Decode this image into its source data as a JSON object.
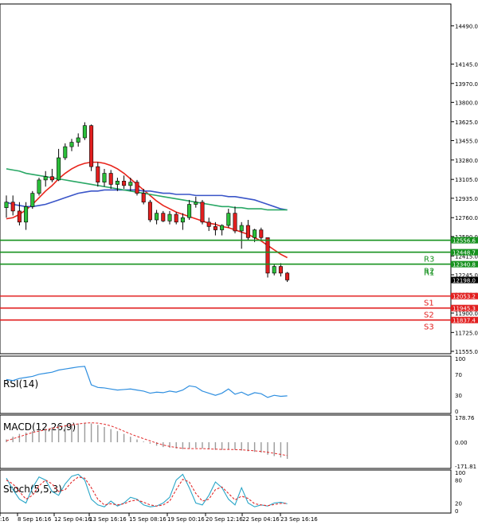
{
  "chart_data": [
    {
      "type": "candlestick",
      "name": "price",
      "ylim": [
        11555.0,
        14665.0
      ],
      "y_ticks": [
        "14490.0",
        "14145.0",
        "13970.0",
        "13800.0",
        "13625.0",
        "13455.0",
        "13280.0",
        "13105.0",
        "12935.0",
        "12760.0",
        "12590.0",
        "12415.0",
        "12245.0",
        "12070.0",
        "11900.0",
        "11725.0",
        "11555.0"
      ],
      "candles": [
        {
          "o": 12850,
          "h": 12960,
          "l": 12760,
          "c": 12900
        },
        {
          "o": 12900,
          "h": 12960,
          "l": 12780,
          "c": 12820
        },
        {
          "o": 12820,
          "h": 12900,
          "l": 12690,
          "c": 12720
        },
        {
          "o": 12720,
          "h": 12900,
          "l": 12650,
          "c": 12860
        },
        {
          "o": 12860,
          "h": 13000,
          "l": 12840,
          "c": 12980
        },
        {
          "o": 12980,
          "h": 13120,
          "l": 12960,
          "c": 13100
        },
        {
          "o": 13100,
          "h": 13180,
          "l": 13040,
          "c": 13130
        },
        {
          "o": 13130,
          "h": 13200,
          "l": 13080,
          "c": 13100
        },
        {
          "o": 13100,
          "h": 13380,
          "l": 13090,
          "c": 13300
        },
        {
          "o": 13300,
          "h": 13430,
          "l": 13280,
          "c": 13400
        },
        {
          "o": 13400,
          "h": 13470,
          "l": 13360,
          "c": 13440
        },
        {
          "o": 13440,
          "h": 13520,
          "l": 13400,
          "c": 13480
        },
        {
          "o": 13480,
          "h": 13620,
          "l": 13460,
          "c": 13590
        },
        {
          "o": 13590,
          "h": 13600,
          "l": 13180,
          "c": 13220
        },
        {
          "o": 13220,
          "h": 13260,
          "l": 13040,
          "c": 13080
        },
        {
          "o": 13080,
          "h": 13200,
          "l": 13040,
          "c": 13160
        },
        {
          "o": 13160,
          "h": 13190,
          "l": 13020,
          "c": 13060
        },
        {
          "o": 13060,
          "h": 13120,
          "l": 13000,
          "c": 13090
        },
        {
          "o": 13090,
          "h": 13140,
          "l": 13020,
          "c": 13050
        },
        {
          "o": 13050,
          "h": 13120,
          "l": 13000,
          "c": 13080
        },
        {
          "o": 13080,
          "h": 13100,
          "l": 12960,
          "c": 12980
        },
        {
          "o": 12980,
          "h": 13020,
          "l": 12880,
          "c": 12900
        },
        {
          "o": 12900,
          "h": 12920,
          "l": 12720,
          "c": 12740
        },
        {
          "o": 12740,
          "h": 12830,
          "l": 12700,
          "c": 12800
        },
        {
          "o": 12800,
          "h": 12820,
          "l": 12720,
          "c": 12730
        },
        {
          "o": 12730,
          "h": 12820,
          "l": 12700,
          "c": 12790
        },
        {
          "o": 12790,
          "h": 12810,
          "l": 12700,
          "c": 12720
        },
        {
          "o": 12720,
          "h": 12800,
          "l": 12650,
          "c": 12760
        },
        {
          "o": 12760,
          "h": 12920,
          "l": 12740,
          "c": 12880
        },
        {
          "o": 12880,
          "h": 12950,
          "l": 12850,
          "c": 12900
        },
        {
          "o": 12900,
          "h": 12920,
          "l": 12700,
          "c": 12720
        },
        {
          "o": 12720,
          "h": 12760,
          "l": 12640,
          "c": 12680
        },
        {
          "o": 12680,
          "h": 12720,
          "l": 12600,
          "c": 12650
        },
        {
          "o": 12650,
          "h": 12700,
          "l": 12600,
          "c": 12690
        },
        {
          "o": 12690,
          "h": 12840,
          "l": 12670,
          "c": 12800
        },
        {
          "o": 12800,
          "h": 12860,
          "l": 12620,
          "c": 12640
        },
        {
          "o": 12640,
          "h": 12720,
          "l": 12480,
          "c": 12690
        },
        {
          "o": 12690,
          "h": 12740,
          "l": 12560,
          "c": 12580
        },
        {
          "o": 12580,
          "h": 12660,
          "l": 12540,
          "c": 12650
        },
        {
          "o": 12650,
          "h": 12670,
          "l": 12560,
          "c": 12580
        },
        {
          "o": 12580,
          "h": 12520,
          "l": 12220,
          "c": 12260
        },
        {
          "o": 12260,
          "h": 12340,
          "l": 12240,
          "c": 12320
        },
        {
          "o": 12320,
          "h": 12350,
          "l": 12230,
          "c": 12260
        },
        {
          "o": 12260,
          "h": 12270,
          "l": 12180,
          "c": 12198
        }
      ],
      "moving_averages": [
        {
          "color": "#e8251c",
          "values": [
            12750,
            12760,
            12790,
            12830,
            12880,
            12940,
            13000,
            13050,
            13110,
            13160,
            13200,
            13230,
            13250,
            13260,
            13260,
            13250,
            13230,
            13200,
            13160,
            13110,
            13060,
            13010,
            12960,
            12910,
            12870,
            12840,
            12810,
            12790,
            12770,
            12750,
            12730,
            12710,
            12700,
            12680,
            12670,
            12650,
            12630,
            12610,
            12580,
            12550,
            12510,
            12470,
            12430,
            12400
          ]
        },
        {
          "color": "#3a55c8",
          "values": [
            12900,
            12880,
            12870,
            12860,
            12860,
            12870,
            12880,
            12900,
            12920,
            12940,
            12960,
            12980,
            12990,
            13000,
            13000,
            13010,
            13010,
            13010,
            13010,
            13010,
            13010,
            13000,
            13000,
            12990,
            12980,
            12980,
            12970,
            12970,
            12970,
            12960,
            12960,
            12960,
            12960,
            12960,
            12950,
            12950,
            12940,
            12930,
            12920,
            12900,
            12880,
            12860,
            12840,
            12830
          ]
        },
        {
          "color": "#2aa866",
          "values": [
            13200,
            13190,
            13180,
            13160,
            13150,
            13140,
            13130,
            13120,
            13110,
            13100,
            13090,
            13080,
            13070,
            13060,
            13050,
            13040,
            13030,
            13020,
            13010,
            13000,
            12990,
            12980,
            12970,
            12960,
            12950,
            12940,
            12930,
            12920,
            12910,
            12900,
            12890,
            12880,
            12870,
            12860,
            12860,
            12850,
            12850,
            12840,
            12840,
            12840,
            12830,
            12830,
            12830,
            12830
          ]
        }
      ],
      "levels": [
        {
          "label": "",
          "value_text": "12556.6",
          "value": 12556.6,
          "color": "#16911e"
        },
        {
          "label": "R3",
          "value_text": "12448.7",
          "value": 12448.7,
          "color": "#16911e"
        },
        {
          "label": "R2",
          "value_text": "12340.8",
          "value": 12340.8,
          "color": "#16911e"
        },
        {
          "label": "S1",
          "value_text": "12053.2",
          "value": 12053.2,
          "color": "#e21f1f"
        },
        {
          "label": "S2",
          "value_text": "11945.3",
          "value": 11945.3,
          "color": "#e21f1f"
        },
        {
          "label": "S3",
          "value_text": "11837.4",
          "value": 11837.4,
          "color": "#e21f1f"
        }
      ],
      "r1_label": "R1",
      "current_price": "12198.0"
    },
    {
      "type": "line",
      "name": "RSI(14)",
      "ylim": [
        0,
        100
      ],
      "y_ticks": [
        "100",
        "70",
        "30",
        "0"
      ],
      "color": "#2f8fe0",
      "values": [
        60,
        58,
        62,
        64,
        66,
        70,
        72,
        74,
        78,
        80,
        82,
        84,
        85,
        50,
        45,
        44,
        42,
        40,
        41,
        42,
        40,
        38,
        34,
        36,
        35,
        38,
        36,
        40,
        48,
        46,
        38,
        34,
        30,
        34,
        42,
        32,
        36,
        30,
        35,
        33,
        26,
        30,
        28,
        29
      ]
    },
    {
      "type": "bar",
      "name": "MACD(12,26,9)",
      "ylim": [
        -171.81,
        178.76
      ],
      "y_ticks": [
        "178.76",
        "0.00",
        "-171.81"
      ],
      "values": [
        20,
        40,
        60,
        70,
        80,
        90,
        100,
        110,
        120,
        125,
        130,
        135,
        140,
        135,
        125,
        110,
        95,
        80,
        60,
        40,
        20,
        5,
        -10,
        -25,
        -35,
        -40,
        -45,
        -50,
        -45,
        -40,
        -45,
        -50,
        -55,
        -55,
        -50,
        -55,
        -60,
        -65,
        -70,
        -75,
        -90,
        -100,
        -110,
        -120
      ],
      "signal": [
        10,
        25,
        40,
        55,
        70,
        80,
        90,
        100,
        110,
        118,
        125,
        132,
        138,
        140,
        138,
        130,
        118,
        100,
        80,
        60,
        42,
        26,
        10,
        -6,
        -20,
        -30,
        -38,
        -44,
        -46,
        -46,
        -46,
        -48,
        -50,
        -52,
        -52,
        -53,
        -55,
        -58,
        -62,
        -66,
        -72,
        -80,
        -88,
        -96
      ],
      "signal_color": "#e22a2a"
    },
    {
      "type": "line",
      "name": "Stoch(5,5,3)",
      "ylim": [
        0,
        100
      ],
      "y_ticks": [
        "100",
        "80",
        "20",
        "0"
      ],
      "series": [
        {
          "color": "#2aa6c8",
          "values": [
            85,
            55,
            30,
            20,
            60,
            88,
            80,
            50,
            40,
            70,
            90,
            95,
            80,
            30,
            15,
            10,
            25,
            12,
            20,
            35,
            30,
            15,
            10,
            12,
            20,
            35,
            80,
            95,
            60,
            20,
            15,
            40,
            75,
            60,
            30,
            15,
            60,
            20,
            10,
            15,
            12,
            20,
            22,
            18
          ]
        },
        {
          "color": "#e22a2a",
          "values": [
            80,
            70,
            50,
            30,
            40,
            65,
            80,
            70,
            50,
            55,
            75,
            88,
            85,
            60,
            30,
            15,
            18,
            15,
            18,
            25,
            28,
            22,
            15,
            12,
            15,
            25,
            55,
            82,
            75,
            45,
            25,
            30,
            55,
            62,
            45,
            28,
            38,
            32,
            18,
            15,
            13,
            16,
            19,
            19
          ]
        }
      ]
    }
  ],
  "x_labels": [
    ":16",
    "8 Sep 16:16",
    "12 Sep 04:16",
    "13 Sep 16:16",
    "15 Sep 08:16",
    "19 Sep 00:16",
    "20 Sep 12:16",
    "22 Sep 04:16",
    "23 Sep 16:16"
  ]
}
